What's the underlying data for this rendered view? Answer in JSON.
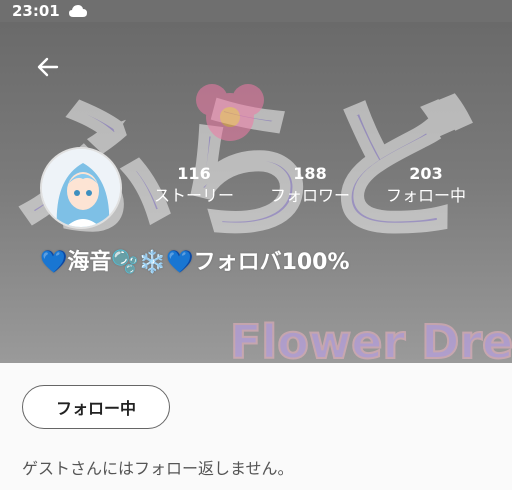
{
  "status_bar": {
    "time": "23:01",
    "icon": "cloud-icon"
  },
  "header": {
    "back_icon": "arrow-left-icon",
    "banner_text": "Flower Dream",
    "banner_logo": "ふらど"
  },
  "profile": {
    "name": "💙海音🫧❄️💙フォロバ100%",
    "stats": {
      "stories": {
        "value": "116",
        "label": "ストーリー"
      },
      "followers": {
        "value": "188",
        "label": "フォロワー"
      },
      "following": {
        "value": "203",
        "label": "フォロー中"
      }
    }
  },
  "actions": {
    "follow_button": "フォロー中"
  },
  "bio": "ゲストさんにはフォロー返しません。",
  "colors": {
    "header_bg": "#6f6f6f",
    "page_bg": "#fafafa",
    "button_border": "#666666"
  }
}
